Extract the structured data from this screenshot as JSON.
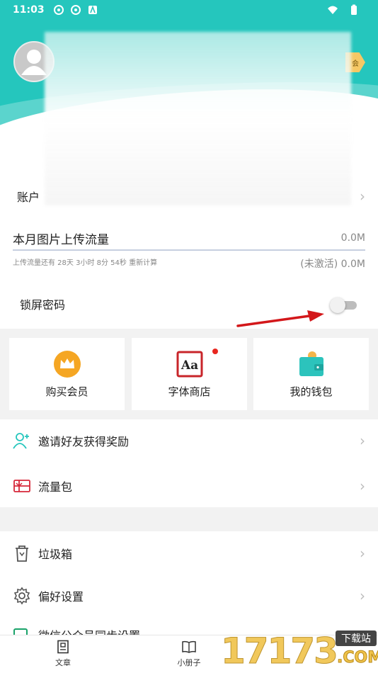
{
  "status_bar": {
    "time": "11:03"
  },
  "header": {
    "vip_tag_text": "会"
  },
  "account_row": {
    "label": "账户"
  },
  "upload": {
    "title": "本月图片上传流量",
    "value": "0.0M",
    "hint": "上传流量还有 28天 3小时 8分 54秒 重新计算",
    "status": "(未激活) 0.0M",
    "progress_fraction": 0
  },
  "lock": {
    "label": "锁屏密码",
    "enabled": false
  },
  "cards": [
    {
      "label": "购买会员",
      "icon": "crown-icon"
    },
    {
      "label": "字体商店",
      "icon": "font-store-icon",
      "badge": true
    },
    {
      "label": "我的钱包",
      "icon": "wallet-icon"
    }
  ],
  "list_section_1": [
    {
      "label": "邀请好友获得奖励",
      "icon": "invite-friend-icon"
    },
    {
      "label": "流量包",
      "icon": "data-package-icon"
    }
  ],
  "list_section_2": [
    {
      "label": "垃圾箱",
      "icon": "trash-icon"
    },
    {
      "label": "偏好设置",
      "icon": "gear-icon"
    },
    {
      "label": "微信公众号同步设置",
      "icon": "wechat-sync-icon"
    }
  ],
  "bottom_nav": [
    {
      "label": "文章",
      "icon": "article-icon"
    },
    {
      "label": "小册子",
      "icon": "booklet-icon"
    }
  ],
  "watermark": {
    "number": "17173",
    "badge": "下载站",
    "suffix": ".COM"
  },
  "colors": {
    "accent": "#25c6bd",
    "alert_red": "#e8261f",
    "crown_orange": "#f5a623"
  }
}
